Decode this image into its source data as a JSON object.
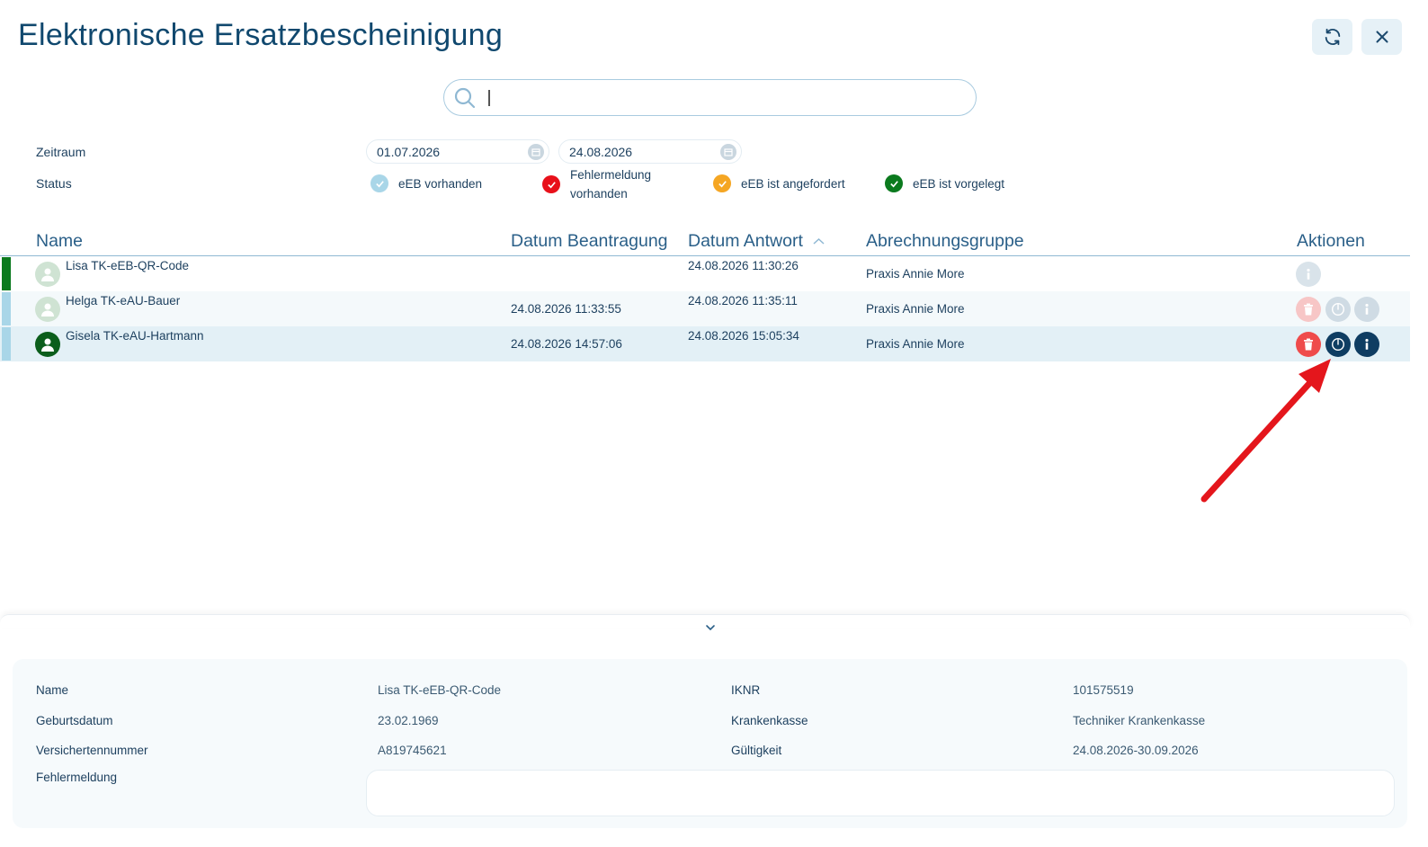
{
  "header": {
    "title": "Elektronische Ersatzbescheinigung",
    "refresh_icon": "refresh-icon",
    "close_icon": "close-icon"
  },
  "search": {
    "placeholder": "",
    "value": ""
  },
  "filters": {
    "zeitraum_label": "Zeitraum",
    "status_label": "Status",
    "date_from": "01.07.2026",
    "date_to": "24.08.2026"
  },
  "legend": [
    {
      "label": "eEB vorhanden",
      "color": "#a9d6e8"
    },
    {
      "label_line1": "Fehlermeldung",
      "label_line2": "vorhanden",
      "color": "#e8101a"
    },
    {
      "label": "eEB ist angefordert",
      "color": "#f5a623"
    },
    {
      "label": "eEB ist vorgelegt",
      "color": "#0b7a1e"
    }
  ],
  "table": {
    "headers": {
      "name": "Name",
      "datum_beantragung": "Datum Beantragung",
      "datum_antwort": "Datum Antwort",
      "abrechnungsgruppe": "Abrechnungsgruppe",
      "aktionen": "Aktionen"
    },
    "rows": [
      {
        "name": "Lisa TK-eEB-QR-Code",
        "beantragung": "",
        "antwort": "24.08.2026 11:30:26",
        "gruppe": "Praxis Annie More",
        "status_color": "#0b7a1e"
      },
      {
        "name": "Helga TK-eAU-Bauer",
        "beantragung": "24.08.2026 11:33:55",
        "antwort": "24.08.2026 11:35:11",
        "gruppe": "Praxis Annie More",
        "status_color": "#a9d6e8"
      },
      {
        "name": "Gisela TK-eAU-Hartmann",
        "beantragung": "24.08.2026 14:57:06",
        "antwort": "24.08.2026 15:05:34",
        "gruppe": "Praxis Annie More",
        "status_color": "#a9d6e8"
      }
    ]
  },
  "details": {
    "name_label": "Name",
    "name_value": "Lisa TK-eEB-QR-Code",
    "geburtsdatum_label": "Geburtsdatum",
    "geburtsdatum_value": "23.02.1969",
    "versichertennummer_label": "Versichertennummer",
    "versichertennummer_value": "A819745621",
    "fehlermeldung_label": "Fehlermeldung",
    "fehlermeldung_value": "",
    "iknr_label": "IKNR",
    "iknr_value": "101575519",
    "krankenkasse_label": "Krankenkasse",
    "krankenkasse_value": "Techniker Krankenkasse",
    "gueltigkeit_label": "Gültigkeit",
    "gueltigkeit_value": "24.08.2026-30.09.2026"
  },
  "colors": {
    "title": "#10486e",
    "delete": "#ef4b4b",
    "delete_disabled": "#f7c6c6",
    "primary_action": "#0f3d62",
    "disabled_action": "#cfdbe4",
    "selected_row": "#e3f0f6",
    "alt_row": "#f4f9fb",
    "annotation_arrow": "#e4161c"
  }
}
